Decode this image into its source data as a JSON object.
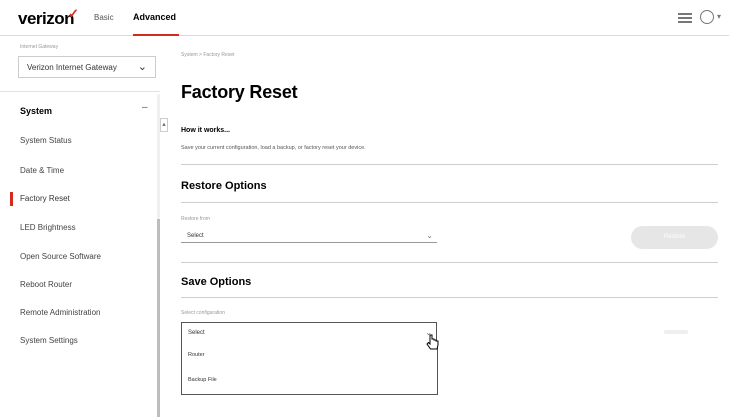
{
  "header": {
    "logo": "verizon",
    "logo_mark": "✓",
    "nav": {
      "basic": "Basic",
      "advanced": "Advanced"
    },
    "icons": [
      "menu-icon",
      "user-icon",
      "chevron-down-icon"
    ]
  },
  "sidebar": {
    "device_label": "Internet Gateway",
    "device_value": "Verizon Internet Gateway",
    "section": "System",
    "items": [
      {
        "label": "System Status"
      },
      {
        "label": "Date & Time"
      },
      {
        "label": "Factory Reset",
        "active": true
      },
      {
        "label": "LED Brightness"
      },
      {
        "label": "Open Source Software"
      },
      {
        "label": "Reboot Router"
      },
      {
        "label": "Remote Administration"
      },
      {
        "label": "System Settings"
      }
    ]
  },
  "main": {
    "breadcrumb": "System > Factory Reset",
    "title": "Factory Reset",
    "how_title": "How it works...",
    "how_desc": "Save your current configuration, load a backup, or factory reset your device.",
    "restore": {
      "title": "Restore Options",
      "field_label": "Restore from",
      "value": "Select",
      "button": "Restore"
    },
    "save": {
      "title": "Save Options",
      "field_label": "Select configuration",
      "value": "Select",
      "options": [
        "Router",
        "Backup File"
      ]
    }
  },
  "colors": {
    "accent": "#d52b1e",
    "text": "#000000",
    "muted": "#999999",
    "button_disabled": "#e6e6e6"
  }
}
